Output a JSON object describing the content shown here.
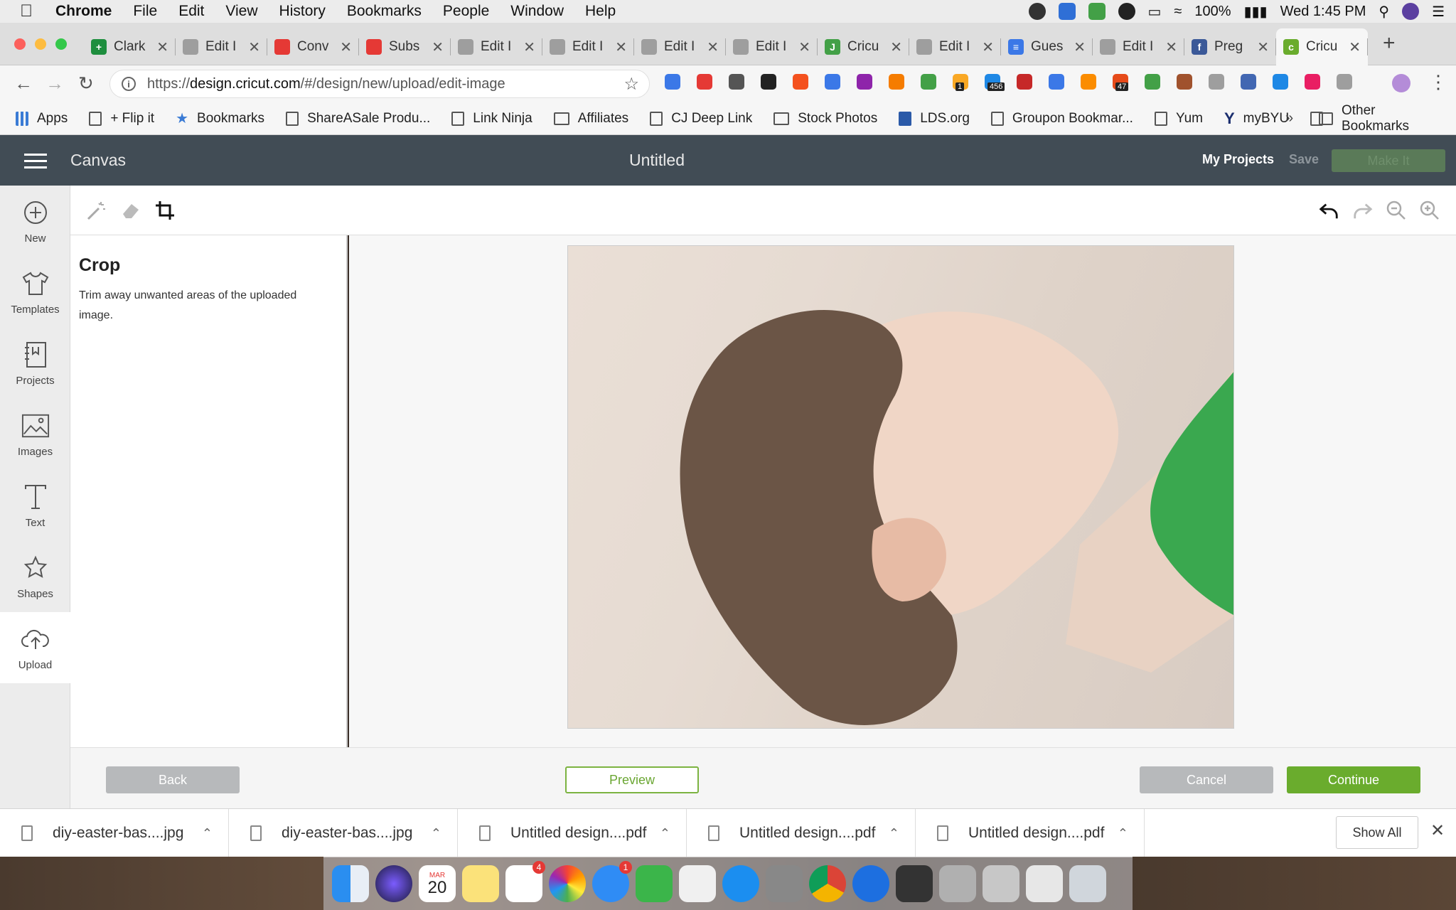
{
  "menubar": {
    "app": "Chrome",
    "items": [
      "File",
      "Edit",
      "View",
      "History",
      "Bookmarks",
      "People",
      "Window",
      "Help"
    ],
    "battery": "100%",
    "clock": "Wed 1:45 PM"
  },
  "tabs": [
    {
      "title": "Clark",
      "color": "#1e8e3e",
      "glyph": "+"
    },
    {
      "title": "Edit I",
      "color": "#9e9e9e",
      "glyph": ""
    },
    {
      "title": "Conv",
      "color": "#e53935",
      "glyph": ""
    },
    {
      "title": "Subs",
      "color": "#e53935",
      "glyph": ""
    },
    {
      "title": "Edit I",
      "color": "#9e9e9e",
      "glyph": ""
    },
    {
      "title": "Edit I",
      "color": "#9e9e9e",
      "glyph": ""
    },
    {
      "title": "Edit I",
      "color": "#9e9e9e",
      "glyph": ""
    },
    {
      "title": "Edit I",
      "color": "#9e9e9e",
      "glyph": ""
    },
    {
      "title": "Cricu",
      "color": "#43a047",
      "glyph": "J"
    },
    {
      "title": "Edit I",
      "color": "#9e9e9e",
      "glyph": ""
    },
    {
      "title": "Gues",
      "color": "#3b78e7",
      "glyph": "≡"
    },
    {
      "title": "Edit I",
      "color": "#9e9e9e",
      "glyph": ""
    },
    {
      "title": "Preg",
      "color": "#3b5998",
      "glyph": "f"
    },
    {
      "title": "Cricu",
      "color": "#6aac2d",
      "glyph": "c"
    }
  ],
  "address": {
    "prefix": "https://",
    "host": "design.cricut.com",
    "path": "/#/design/new/upload/edit-image"
  },
  "extensions": {
    "colors": [
      "#3b78e7",
      "#e53935",
      "#555",
      "#222",
      "#f4511e",
      "#3b78e7",
      "#8e24aa",
      "#f57c00",
      "#43a047",
      "#f9a825",
      "#1e88e5",
      "#c62828",
      "#3b78e7",
      "#fb8c00",
      "#e64a19",
      "#43a047",
      "#a0522d",
      "#9e9e9e",
      "#4267b2",
      "#1e88e5",
      "#e91e63",
      "#9e9e9e"
    ],
    "badge_a": "1",
    "badge_b": "456",
    "badge_c": "47"
  },
  "bookmarks": [
    {
      "label": "Apps",
      "kind": "grid"
    },
    {
      "label": "+ Flip it",
      "kind": "page"
    },
    {
      "label": "Bookmarks",
      "kind": "star"
    },
    {
      "label": "ShareASale Produ...",
      "kind": "page"
    },
    {
      "label": "Link Ninja",
      "kind": "page"
    },
    {
      "label": "Affiliates",
      "kind": "folder"
    },
    {
      "label": "CJ Deep Link",
      "kind": "page"
    },
    {
      "label": "Stock Photos",
      "kind": "folder"
    },
    {
      "label": "LDS.org",
      "kind": "lds"
    },
    {
      "label": "Groupon Bookmar...",
      "kind": "page"
    },
    {
      "label": "Yum",
      "kind": "page"
    },
    {
      "label": "myBYU",
      "kind": "y"
    }
  ],
  "bookmarks_more": "»",
  "bookmarks_other": "Other Bookmarks",
  "app": {
    "brand": "Canvas",
    "title": "Untitled",
    "my_projects": "My Projects",
    "save": "Save",
    "make_it": "Make It"
  },
  "sidebar": [
    {
      "label": "New",
      "icon": "plus-circle"
    },
    {
      "label": "Templates",
      "icon": "shirt"
    },
    {
      "label": "Projects",
      "icon": "notebook"
    },
    {
      "label": "Images",
      "icon": "image"
    },
    {
      "label": "Text",
      "icon": "text"
    },
    {
      "label": "Shapes",
      "icon": "shapes"
    },
    {
      "label": "Upload",
      "icon": "cloud-upload"
    }
  ],
  "panel": {
    "title": "Crop",
    "description": "Trim away unwanted areas of the uploaded image."
  },
  "footer": {
    "back": "Back",
    "preview": "Preview",
    "cancel": "Cancel",
    "continue": "Continue"
  },
  "downloads": [
    "diy-easter-bas....jpg",
    "diy-easter-bas....jpg",
    "Untitled design....pdf",
    "Untitled design....pdf",
    "Untitled design....pdf"
  ],
  "downloads_show_all": "Show All",
  "dock": {
    "calendar_month": "MAR",
    "calendar_day": "20",
    "reminders_badge": "4",
    "messages_badge": "1"
  }
}
